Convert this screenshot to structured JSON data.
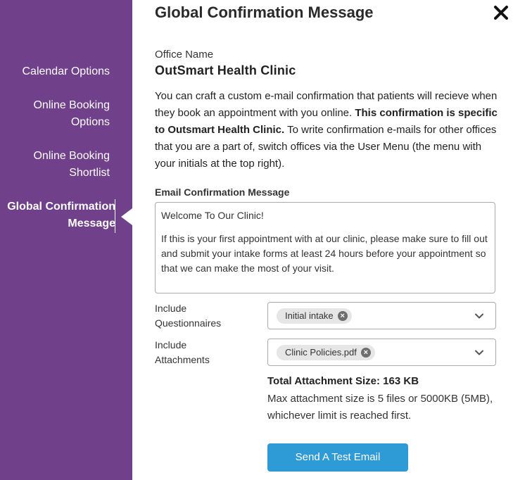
{
  "sidebar": {
    "items": [
      {
        "line1": "Calendar Options",
        "line2": ""
      },
      {
        "line1": "Online Booking",
        "line2": "Options"
      },
      {
        "line1": "Online Booking",
        "line2": "Shortlist"
      },
      {
        "line1": "Global Confirmation",
        "line2": "Message"
      }
    ],
    "active_index": 3,
    "background_color": "#70408a"
  },
  "header": {
    "title": "Global Confirmation Message",
    "close_icon": "close-icon"
  },
  "office": {
    "label": "Office Name",
    "name": "OutSmart Health Clinic"
  },
  "description": {
    "part1": "You can craft a custom e-mail confirmation that patients will recieve when they book an appointment with you online. ",
    "bold": "This confirmation is specific to Outsmart Health Clinic.",
    "part2": " To write confirmation e-mails for other offices that you are a part of, switch offices via the User Menu (the menu with your initials at the top right)."
  },
  "email_message": {
    "label": "Email Confirmation Message",
    "paragraph1": "Welcome To Our Clinic!",
    "paragraph2": "If this is your first appointment with at our clinic, please make sure to fill out and submit your intake forms at least 24 hours before your appointment so that we can make the most of your visit."
  },
  "questionnaires": {
    "label_line1": "Include",
    "label_line2": "Questionnaires",
    "chip": "Initial intake"
  },
  "attachments": {
    "label_line1": "Include",
    "label_line2": "Attachments",
    "chip": "Clinic Policies.pdf",
    "total": "Total Attachment Size: 163 KB",
    "max_note": "Max attachment size is 5 files or 5000KB (5MB), whichever limit is reached first."
  },
  "actions": {
    "send_test_label": "Send A Test Email",
    "button_color": "#2e9bd6"
  }
}
